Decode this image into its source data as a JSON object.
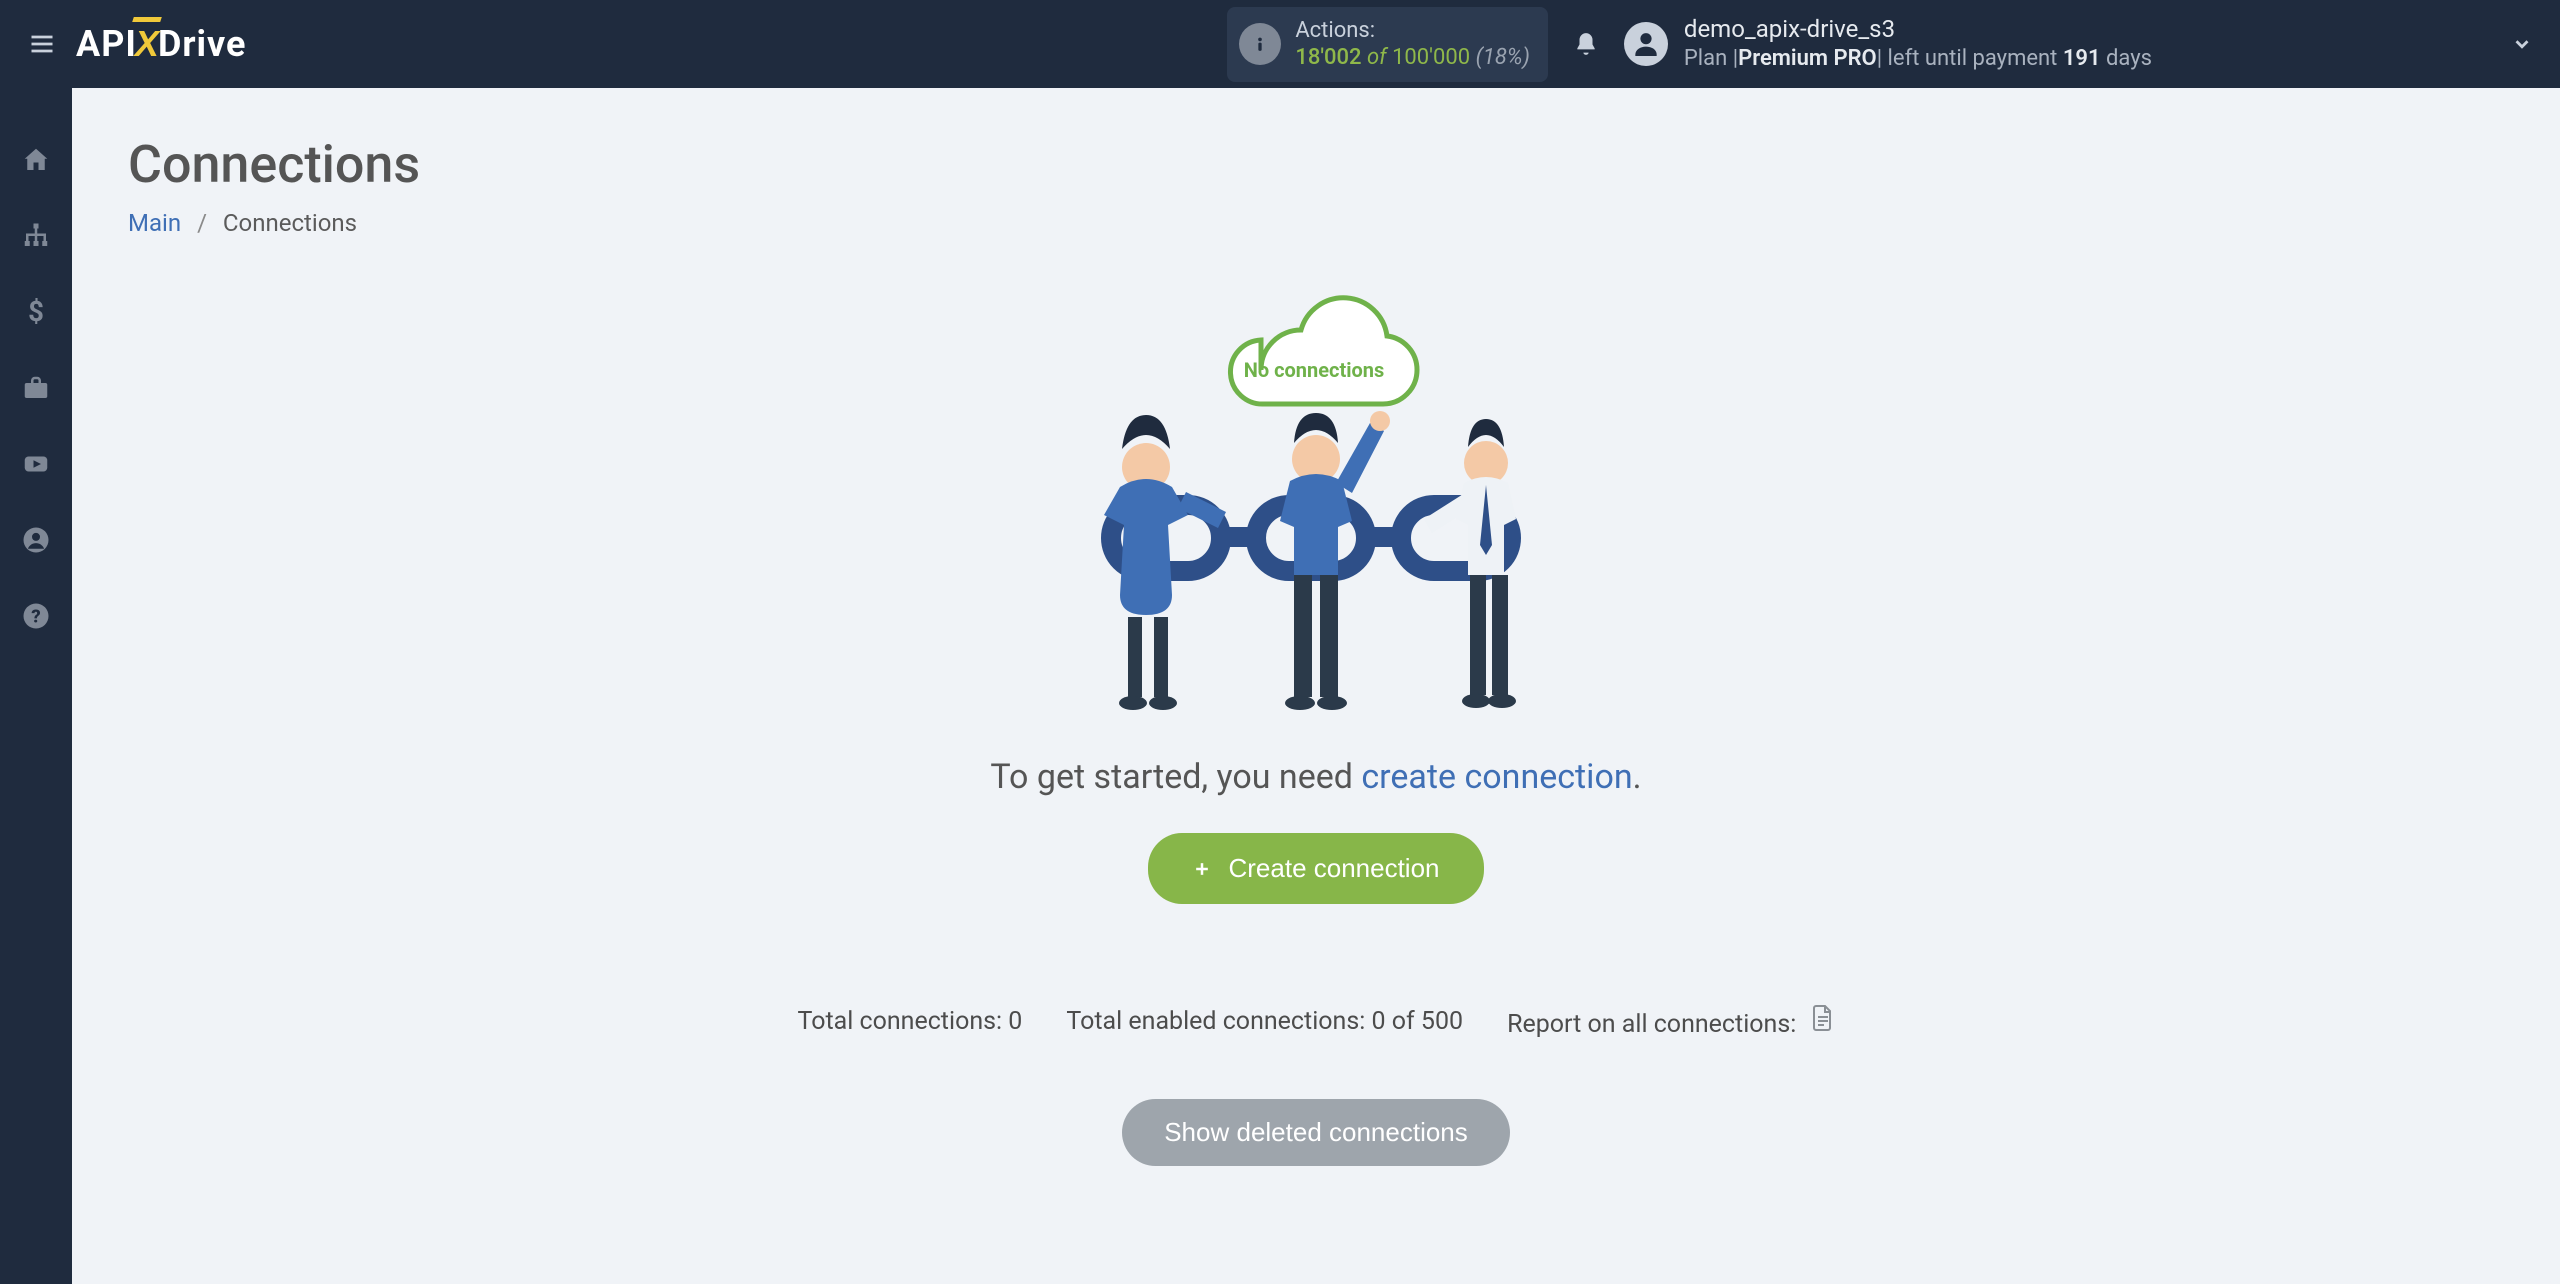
{
  "header": {
    "logo": {
      "part1": "API",
      "part2": "X",
      "part3": "Drive"
    },
    "actions": {
      "label": "Actions:",
      "used": "18'002",
      "of": "of",
      "total": "100'000",
      "pct": "(18%)"
    },
    "user": {
      "name": "demo_apix-drive_s3",
      "plan_prefix": "Plan |",
      "plan_name": "Premium PRO",
      "plan_sep": "|",
      "plan_rest1": " left until payment ",
      "plan_days": "191",
      "plan_rest2": " days"
    }
  },
  "page": {
    "title": "Connections",
    "breadcrumb": {
      "main": "Main",
      "current": "Connections"
    }
  },
  "empty": {
    "cloud_text": "No connections",
    "prefix": "To get started, you need ",
    "link": "create connection",
    "suffix": ".",
    "button": "Create connection"
  },
  "stats": {
    "total_label": "Total connections:",
    "total_value": "0",
    "enabled_label": "Total enabled connections:",
    "enabled_value": "0 of 500",
    "report_label": "Report on all connections:"
  },
  "deleted_btn": "Show deleted connections"
}
